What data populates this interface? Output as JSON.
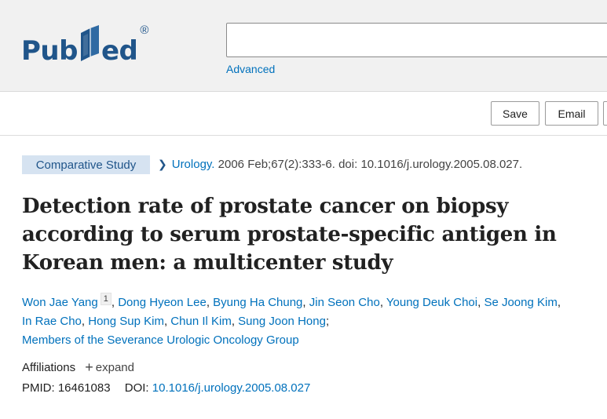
{
  "header": {
    "logo_left": "Pub",
    "logo_right": "ed",
    "logo_reg": "®",
    "search_value": "",
    "advanced_label": "Advanced"
  },
  "actions": {
    "save_label": "Save",
    "email_label": "Email"
  },
  "article": {
    "badge": "Comparative Study",
    "journal": "Urology.",
    "citation_rest": " 2006 Feb;67(2):333-6. doi: 10.1016/j.urology.2005.08.027.",
    "title": "Detection rate of prostate cancer on biopsy according to serum prostate-specific antigen in Korean men: a multicenter study",
    "authors": [
      "Won Jae Yang",
      "Dong Hyeon Lee",
      "Byung Ha Chung",
      "Jin Seon Cho",
      "Young Deuk Choi",
      "Se Joong Kim",
      "In Rae Cho",
      "Hong Sup Kim",
      "Chun Il Kim",
      "Sung Joon Hong"
    ],
    "first_author_sup": "1",
    "group": "Members of the Severance Urologic Oncology Group",
    "affiliations_label": "Affiliations",
    "expand_label": "expand",
    "pmid_label": "PMID:",
    "pmid": "16461083",
    "doi_label": "DOI:",
    "doi": "10.1016/j.urology.2005.08.027"
  },
  "colors": {
    "brand_blue": "#20558a",
    "link_blue": "#0071bc",
    "badge_bg": "#d6e3f1",
    "header_bg": "#f1f1f1"
  }
}
